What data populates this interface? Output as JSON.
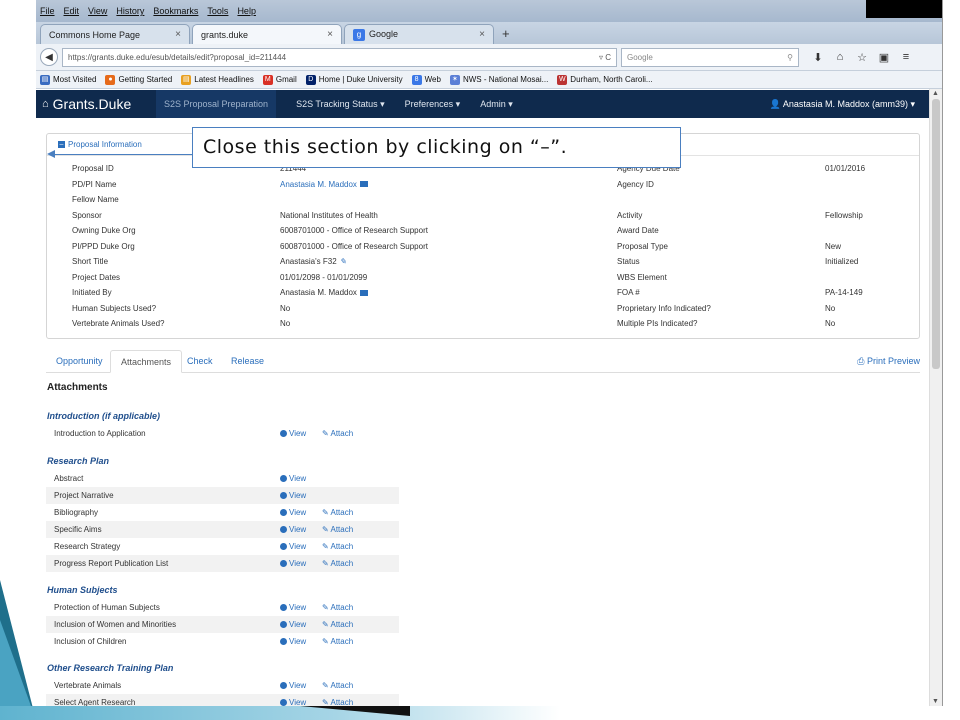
{
  "browser": {
    "menu": [
      "File",
      "Edit",
      "View",
      "History",
      "Bookmarks",
      "Tools",
      "Help"
    ],
    "tabs": [
      {
        "label": "Commons Home Page"
      },
      {
        "label": "grants.duke"
      },
      {
        "label": "Google"
      }
    ],
    "url": "https://grants.duke.edu/esub/details/edit?proposal_id=211444",
    "url_host": "duke.edu",
    "search_placeholder": "Google",
    "bookmarks": [
      "Most Visited",
      "Getting Started",
      "Latest Headlines",
      "Gmail",
      "Home | Duke University",
      "Web",
      "NWS - National Mosai...",
      "Durham, North Caroli..."
    ]
  },
  "app": {
    "brand": "Grants.Duke",
    "nav": [
      "S2S Proposal Preparation",
      "S2S Tracking Status",
      "Preferences",
      "Admin"
    ],
    "user": "Anastasia M. Maddox (amm39)"
  },
  "panel": {
    "title": "Proposal Information",
    "rows": [
      [
        "Proposal ID",
        "211444",
        "Agency Due Date",
        "01/01/2016"
      ],
      [
        "PD/PI Name",
        "Anastasia M. Maddox",
        "Agency ID",
        ""
      ],
      [
        "Fellow Name",
        "",
        "",
        ""
      ],
      [
        "Sponsor",
        "National Institutes of Health",
        "Activity",
        "Fellowship"
      ],
      [
        "Owning Duke Org",
        "6008701000 - Office of Research Support",
        "Award Date",
        ""
      ],
      [
        "PI/PPD Duke Org",
        "6008701000 - Office of Research Support",
        "Proposal Type",
        "New"
      ],
      [
        "Short Title",
        "Anastasia's F32",
        "Status",
        "Initialized"
      ],
      [
        "Project Dates",
        "01/01/2098 - 01/01/2099",
        "WBS Element",
        ""
      ],
      [
        "Initiated By",
        "Anastasia M. Maddox",
        "FOA #",
        "PA-14-149"
      ],
      [
        "Human Subjects Used?",
        "No",
        "Proprietary Info Indicated?",
        "No"
      ],
      [
        "Vertebrate Animals Used?",
        "No",
        "Multiple PIs Indicated?",
        "No"
      ]
    ]
  },
  "callout": "Close this section by clicking on “–”.",
  "tabs": [
    "Opportunity",
    "Attachments",
    "Check",
    "Release"
  ],
  "print_label": "Print Preview",
  "attachments_heading": "Attachments",
  "view_label": "View",
  "attach_label": "Attach",
  "sections": [
    {
      "title": "Introduction (if applicable)",
      "items": [
        {
          "name": "Introduction to Application",
          "attach": true
        }
      ]
    },
    {
      "title": "Research Plan",
      "items": [
        {
          "name": "Abstract",
          "attach": false
        },
        {
          "name": "Project Narrative",
          "attach": false
        },
        {
          "name": "Bibliography",
          "attach": true
        },
        {
          "name": "Specific Aims",
          "attach": true
        },
        {
          "name": "Research Strategy",
          "attach": true
        },
        {
          "name": "Progress Report Publication List",
          "attach": true
        }
      ]
    },
    {
      "title": "Human Subjects",
      "items": [
        {
          "name": "Protection of Human Subjects",
          "attach": true
        },
        {
          "name": "Inclusion of Women and Minorities",
          "attach": true
        },
        {
          "name": "Inclusion of Children",
          "attach": true
        }
      ]
    },
    {
      "title": "Other Research Training Plan",
      "items": [
        {
          "name": "Vertebrate Animals",
          "attach": true
        },
        {
          "name": "Select Agent Research",
          "attach": true
        }
      ]
    }
  ]
}
